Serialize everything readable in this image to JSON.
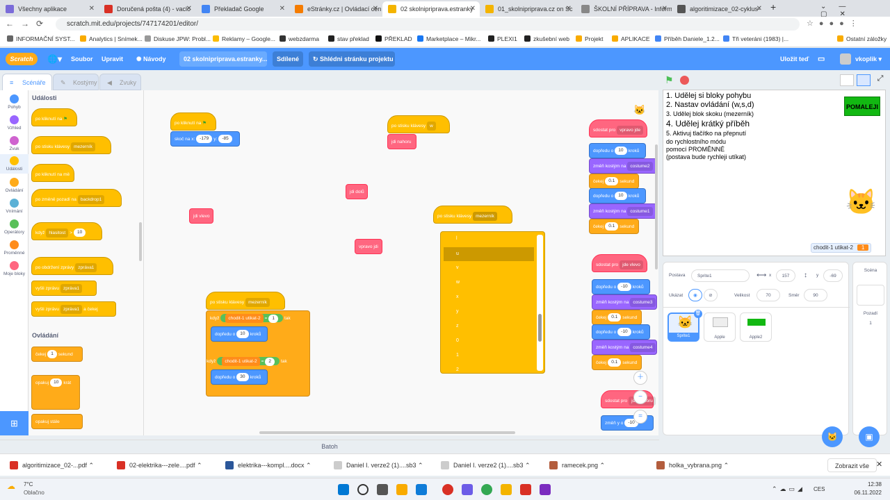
{
  "browser": {
    "tabs": [
      {
        "label": "Všechny aplikace",
        "color": "#7b6cd9"
      },
      {
        "label": "Doručená pošta (4) - vaclo",
        "color": "#d93025"
      },
      {
        "label": "Překladač Google",
        "color": "#4285f4"
      },
      {
        "label": "eStránky.cz | Ovládací cen",
        "color": "#f57c00"
      },
      {
        "label": "02 skolnipriprava.estranky",
        "color": "#f4b400"
      },
      {
        "label": "01_skolnipriprava.cz on Sc",
        "color": "#f4b400"
      },
      {
        "label": "ŠKOLNÍ PŘÍPRAVA - Inform",
        "color": "#888"
      },
      {
        "label": "algoritimizace_02-cyklus-",
        "color": "#555"
      }
    ],
    "url": "scratch.mit.edu/projects/747174201/editor/",
    "bookmarks": [
      "INFORMAČNÍ SYST...",
      "Analytics | Snímek...",
      "Diskuse JPW: Probl...",
      "Reklamy – Google...",
      "webzdarma",
      "stav překlad",
      "PŘEKLAD",
      "Marketplace – Mikr...",
      "PLEXI1",
      "zkušební web",
      "Projekt",
      "APLIKACE",
      "Příběh Daniele_1.2...",
      "Tři veteráni (1983) |...",
      "Ostatní záložky"
    ]
  },
  "menu": {
    "soubor": "Soubor",
    "upravit": "Upravit",
    "navody": "Návody",
    "project": "02 skolnipriprava.estranky...",
    "sdilene": "Sdílené",
    "shlednout": "Shlédni stránku projektu",
    "ulozit": "Uložit teď",
    "user": "vkoplik"
  },
  "editor_tabs": {
    "code": "Scénáře",
    "costumes": "Kostýmy",
    "sounds": "Zvuky"
  },
  "categories": [
    {
      "label": "Pohyb",
      "color": "#4c97ff"
    },
    {
      "label": "Vzhled",
      "color": "#9966ff"
    },
    {
      "label": "Zvuk",
      "color": "#cf63cf"
    },
    {
      "label": "Události",
      "color": "#ffbf00"
    },
    {
      "label": "Ovládání",
      "color": "#ffab19"
    },
    {
      "label": "Vnímání",
      "color": "#5cb1d6"
    },
    {
      "label": "Operátory",
      "color": "#59c059"
    },
    {
      "label": "Proměnné",
      "color": "#ff8c1a"
    },
    {
      "label": "Moje bloky",
      "color": "#ff6680"
    }
  ],
  "palette": {
    "events_title": "Události",
    "control_title": "Ovládání",
    "b1": "po kliknutí na",
    "b2": "po stisku klávesy",
    "b2d": "mezerník",
    "b3": "po kliknutí na mě",
    "b4": "po změně pozadí na",
    "b4d": "backdrop1",
    "b5": "když",
    "b5d": "hlasitost",
    "b5v": "10",
    "b6": "po obdržení zprávy",
    "b6d": "zpráva1",
    "b7": "vyšli zprávu",
    "b7d": "zpráva1",
    "b8": "vyšli zprávu",
    "b8d": "zpráva1",
    "b8e": "a čekej",
    "b9": "čekej",
    "b9v": "1",
    "b9e": "sekund",
    "b10": "opakuj",
    "b10v": "10",
    "b10e": "krát",
    "b11": "opakuj stále"
  },
  "ws": {
    "s1a": "po kliknutí na",
    "s1b": "skoč na x:",
    "s1x": "-179",
    "s1y": "y:",
    "s1yv": "-85",
    "s2a": "po stisku klávesy",
    "s2d": "w",
    "s2b": "jdi nahoru",
    "s3": "jdi dolů",
    "s4": "jdi vlevo",
    "s5": "vpravo jdi",
    "s6a": "po stisku klávesy",
    "s6d": "mezerník",
    "s7a": "po stisku klávesy",
    "s7d": "mezerník",
    "s7if": "když",
    "s7var": "chodit-1 utikat-2",
    "s7eq": "=",
    "s7v1": "1",
    "s7then": "tak",
    "s7mv": "dopředu o",
    "s7mv1": "10",
    "s7kr": "kroků",
    "s7v2": "2",
    "s7mv2": "30",
    "r1": "sdostat pro",
    "r1b": "vpravo jde",
    "r_mv": "dopředu o",
    "r_10": "10",
    "r_kr": "kroků",
    "r_cos": "změň kostým na",
    "r_c2": "costume2",
    "r_c1": "costume1",
    "r_wait": "čekej",
    "r_01": "0.1",
    "r_sek": "sekund",
    "r2": "sdostat pro",
    "r2b": "jde vlevo",
    "r_m10": "-10",
    "r_c3": "costume3",
    "r_c4": "costume4",
    "r3": "sdostat pro",
    "r3b": "jde nahoru",
    "r3y": "změň y o",
    "r3yv": "-10"
  },
  "dropdown": {
    "items": [
      "l",
      "u",
      "v",
      "w",
      "x",
      "y",
      "z",
      "0",
      "1",
      "2"
    ],
    "selected": "u"
  },
  "stage": {
    "line1": "1. Udělej si bloky pohybu",
    "line2": "2. Nastav ovládání (w,s,d)",
    "line3": "3. Udělej blok skoku (mezerník)",
    "line4": "4. Udělej krátký příběh",
    "line5": "5. Aktivuj tlačítko na přepnutí",
    "line6": "do rychlostního módu",
    "line7": "pomocí PROMĚNNÉ",
    "line8": "(postava bude rychleji utíkat)",
    "pomaleji": "POMALEJI",
    "var_name": "chodit-1 utikat-2",
    "var_value": "1"
  },
  "sprite": {
    "label": "Postava",
    "name": "Sprite1",
    "x_label": "x",
    "x": "157",
    "y_label": "y",
    "y": "-69",
    "show": "Ukázat",
    "size_label": "Velikost",
    "size": "70",
    "dir_label": "Směr",
    "dir": "90",
    "sprites": [
      "Sprite1",
      "Apple",
      "Apple2"
    ]
  },
  "scene": {
    "title": "Scéna",
    "backdrops": "Pozadí",
    "count": "1"
  },
  "batoh": "Batoh",
  "downloads": [
    "algoritimizace_02-...pdf",
    "02-elektrika---zele....pdf",
    "elektrika---kompl....docx",
    "Daniel I. verze2 (1)....sb3",
    "Daniel I. verze2 (1)....sb3",
    "ramecek.png",
    "holka_vybrana.png"
  ],
  "show_all": "Zobrazit vše",
  "taskbar": {
    "temp": "7°C",
    "weather": "Oblačno",
    "lang": "CES",
    "time": "12:38",
    "date": "06.11.2022"
  }
}
